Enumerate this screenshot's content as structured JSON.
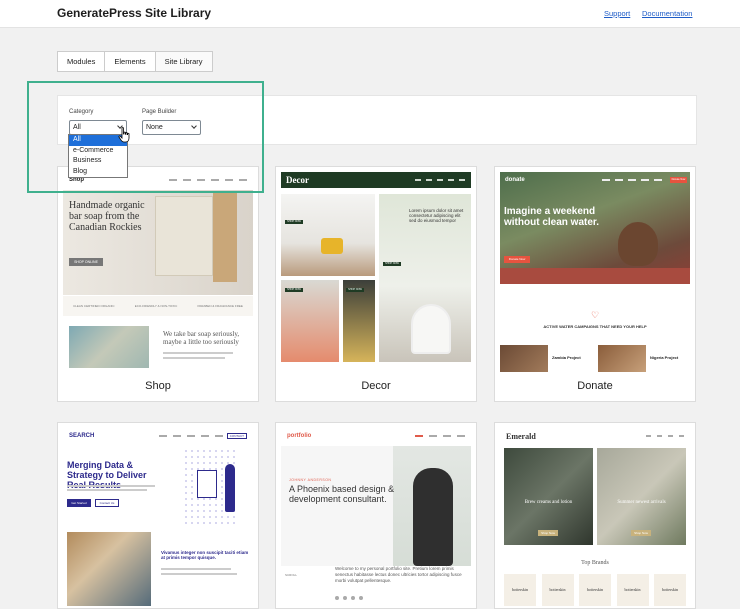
{
  "header": {
    "title": "GeneratePress Site Library",
    "links": {
      "support": "Support",
      "documentation": "Documentation"
    }
  },
  "tabs": [
    {
      "label": "Modules",
      "active": false
    },
    {
      "label": "Elements",
      "active": false
    },
    {
      "label": "Site Library",
      "active": true
    }
  ],
  "filters": {
    "category": {
      "label": "Category",
      "value": "All",
      "options": [
        "All",
        "e-Commerce",
        "Business",
        "Blog"
      ],
      "open": true
    },
    "page_builder": {
      "label": "Page Builder",
      "value": "None"
    }
  },
  "sites": [
    {
      "name": "Shop",
      "preview": {
        "logo": "Shop",
        "heading": "Handmade organic bar soap from the Canadian Rockies",
        "button": "SHOP ONLINE",
        "features": [
          "CLEAN CERTIFIED ORGANIC",
          "ECO-FRIENDLY & NON-TOXIC",
          "PARABEN & FRAGRANCE FREE"
        ],
        "subheading": "We take bar soap seriously, maybe a little too seriously"
      }
    },
    {
      "name": "Decor",
      "preview": {
        "logo": "Decor",
        "text": "Lorem ipsum dolor sit amet consectetur adipiscing elit sed do eiusmod tempor",
        "tags": [
          "SHOP NOW",
          "SHOP NOW",
          "SHOP NOW",
          "SHOP NOW"
        ]
      }
    },
    {
      "name": "Donate",
      "preview": {
        "logo": "donate",
        "donate_button": "Donate Now",
        "heading": "Imagine a weekend without clean water.",
        "hero_button": "Donate Now",
        "tagline": "ACTIVE WATER CAMPAIGNS THAT NEED YOUR HELP",
        "projects": [
          "Zambia Project",
          "Nigeria Project"
        ]
      }
    },
    {
      "name": "",
      "preview": {
        "logo": "SEARCH",
        "nav_button": "CONTACT",
        "heading": "Merging Data & Strategy to Deliver Real Results",
        "buttons": [
          "Get Started",
          "Contact Us"
        ],
        "subheading": "Vivamus integer non suscipit taciti etiam at primis tempor quisque."
      }
    },
    {
      "name": "",
      "preview": {
        "logo": "portfolio",
        "eyebrow": "JOHNNY ANDERSON",
        "heading": "A Phoenix based design & development consultant.",
        "body": "Welcome to my personal portfolio site. Pretium lorem primis senectus habitasse lectus donec ultricies tortor adipiscing fusce morbi volutpat pellentesque.",
        "side_label": "SCROLL"
      }
    },
    {
      "name": "",
      "preview": {
        "logo": "Emerald",
        "tiles": [
          "Brew creams and lotion",
          "Summer newest arrivals"
        ],
        "tile_button": "Shop Now",
        "brands_title": "Top Brands",
        "brand": "botterskin"
      }
    }
  ]
}
